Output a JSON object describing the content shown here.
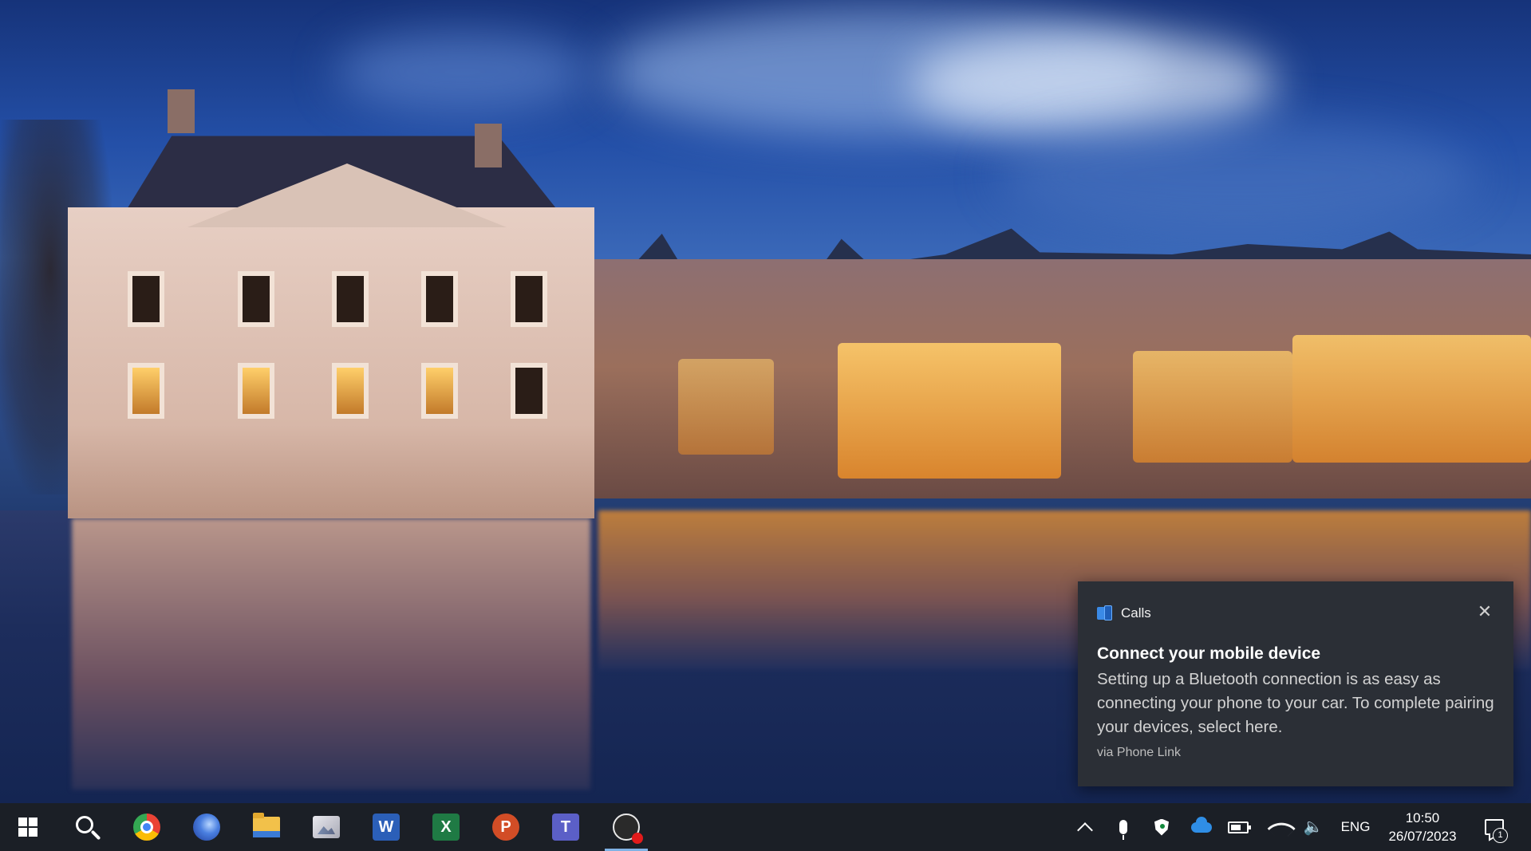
{
  "desktop": {
    "wallpaper_subject": "mauritshuis-binnenhof-dusk"
  },
  "notification": {
    "app_name": "Calls",
    "app_icon": "phone-link-icon",
    "close_glyph": "✕",
    "title": "Connect your mobile device",
    "body": "Setting up a Bluetooth connection is as easy as connecting your phone to your car. To complete pairing your devices, select here.",
    "attribution": "via Phone Link",
    "background_color": "#2b2f36"
  },
  "taskbar": {
    "background_color": "#1b1f26",
    "pinned_apps": [
      {
        "name": "start-icon"
      },
      {
        "name": "search-icon"
      },
      {
        "name": "chrome-icon"
      },
      {
        "name": "firefox-icon"
      },
      {
        "name": "file-explorer-icon"
      },
      {
        "name": "photos-icon"
      },
      {
        "name": "word-icon",
        "glyph": "W"
      },
      {
        "name": "excel-icon",
        "glyph": "X"
      },
      {
        "name": "powerpoint-icon",
        "glyph": "P"
      },
      {
        "name": "teams-icon",
        "glyph": "T"
      },
      {
        "name": "obs-icon",
        "active": true
      }
    ],
    "tray": {
      "overflow_icon": "chevron-up-icon",
      "icons": [
        "microphone-icon",
        "defender-shield-icon",
        "onedrive-cloud-icon",
        "battery-icon",
        "wifi-icon",
        "volume-icon"
      ],
      "volume_glyph": "🔈",
      "language": "ENG",
      "time": "10:50",
      "date": "26/07/2023",
      "notification_count": "1"
    }
  }
}
